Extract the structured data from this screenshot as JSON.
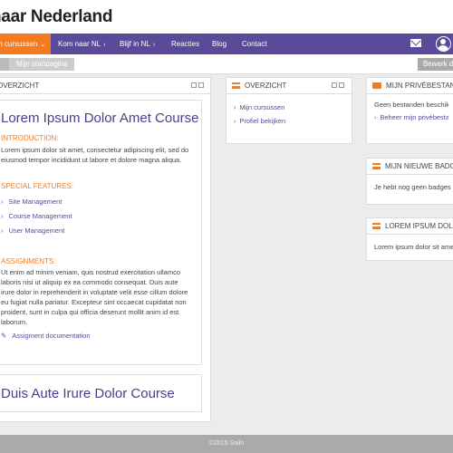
{
  "site": {
    "title": "naar Nederland"
  },
  "nav": {
    "items": [
      {
        "label": "Mijn cursussen",
        "chevron": "v"
      },
      {
        "label": "Kom naar NL",
        "chevron": ">"
      },
      {
        "label": "Blijf in NL",
        "chevron": ">"
      },
      {
        "label": "Reacties",
        "chevron": ""
      },
      {
        "label": "Blog",
        "chevron": ""
      },
      {
        "label": "Contact",
        "chevron": ""
      }
    ],
    "mail_icon": "mail-icon",
    "user_icon": "user-avatar-icon"
  },
  "breadcrumb": {
    "current": "Mijn startpagina",
    "edit_label": "Bewerk d"
  },
  "left_block": {
    "title": "OVERZICHT"
  },
  "course1": {
    "title": "Lorem Ipsum Dolor Amet Course",
    "intro_head": "INTRODUCTION:",
    "intro_text": "Lorem ipsum dolor sit amet, consectetur adipiscing elit, sed do eiusmod tempor incididunt ut labore et dolore magna aliqua.",
    "features_head": "SPECIAL FEATURES:",
    "features": [
      "Site Management",
      "Course Management",
      "User Management"
    ],
    "assign_head": "ASSIGNMENTS:",
    "assign_text": "Ut enim ad minim veniam, quis nostrud exercitation ullamco laboris nisi ut aliquip ex ea commodo consequat. Duis aute irure dolor in reprehenderit in voluptate velit esse cillum dolore eu fugiat nulla pariatur. Excepteur sint occaecat cupidatat non proident, sunt in culpa qui officia deserunt mollit anim id est laborum.",
    "assign_link": "Assigment documentation"
  },
  "course2": {
    "title": "Duis Aute Irure Dolor Course"
  },
  "middle_block": {
    "title": "OVERZICHT",
    "links": [
      "Mijn cursussen",
      "Profiel bekijken"
    ]
  },
  "files_block": {
    "title": "MIJN PRIVÉBESTANDEN",
    "text": "Geen bestanden beschikbaar",
    "link": "Beheer mijn privébestanden"
  },
  "badges_block": {
    "title": "MIJN NIEUWE BADGES",
    "text": "Je hebt nog geen badges om"
  },
  "lorem_block": {
    "title": "LOREM IPSUM DOLOR",
    "text": "Lorem ipsum dolor sit amet"
  },
  "footer": {
    "text": "©2015 Soiln"
  },
  "colors": {
    "accent": "#f47b20",
    "brand": "#5b4a9a"
  }
}
